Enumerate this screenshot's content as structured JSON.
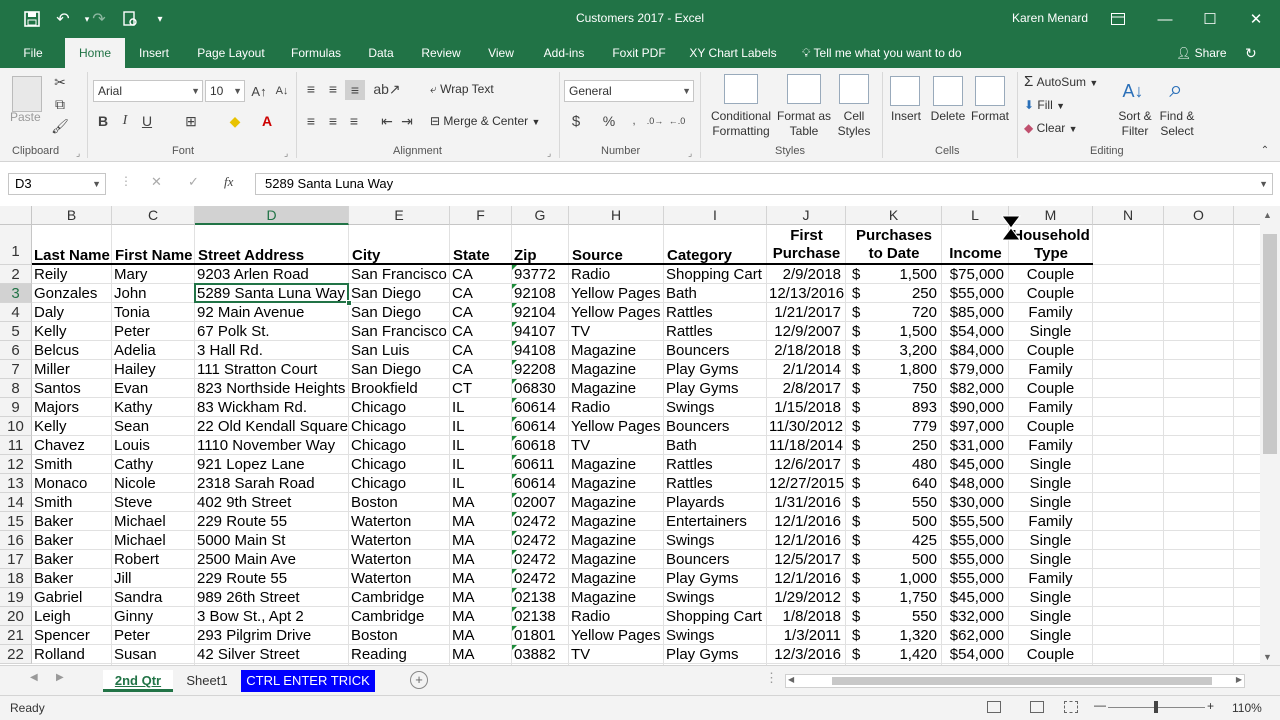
{
  "window": {
    "title": "Customers 2017 - Excel",
    "user": "Karen Menard"
  },
  "ribbon_tabs": [
    "File",
    "Home",
    "Insert",
    "Page Layout",
    "Formulas",
    "Data",
    "Review",
    "View",
    "Add-ins",
    "Foxit PDF",
    "XY Chart Labels"
  ],
  "active_tab": "Home",
  "tell_me": "Tell me what you want to do",
  "share_label": "Share",
  "ribbon": {
    "clipboard": {
      "label": "Clipboard",
      "paste": "Paste"
    },
    "font": {
      "label": "Font",
      "name": "Arial",
      "size": "10",
      "bold": "B",
      "italic": "I",
      "underline": "U"
    },
    "alignment": {
      "label": "Alignment",
      "wrap_text": "Wrap Text",
      "merge_center": "Merge & Center"
    },
    "number": {
      "label": "Number",
      "format": "General",
      "currency": "$",
      "percent": "%"
    },
    "styles": {
      "label": "Styles",
      "cond_fmt_1": "Conditional",
      "cond_fmt_2": "Formatting",
      "fmt_table_1": "Format as",
      "fmt_table_2": "Table",
      "cell_styles_1": "Cell",
      "cell_styles_2": "Styles"
    },
    "cells": {
      "label": "Cells",
      "insert": "Insert",
      "delete": "Delete",
      "format": "Format"
    },
    "editing": {
      "label": "Editing",
      "autosum": "AutoSum",
      "fill": "Fill",
      "clear": "Clear",
      "sort_1": "Sort &",
      "sort_2": "Filter",
      "find_1": "Find &",
      "find_2": "Select"
    }
  },
  "name_box": "D3",
  "formula": "5289 Santa Luna Way",
  "selected_cell": "D3",
  "columns": [
    "B",
    "C",
    "D",
    "E",
    "F",
    "G",
    "H",
    "I",
    "J",
    "K",
    "L",
    "M",
    "N",
    "O"
  ],
  "headers": {
    "B": "Last Name",
    "C": "First Name",
    "D": "Street Address",
    "E": "City",
    "F": "State",
    "G": "Zip",
    "H": "Source",
    "I": "Category",
    "J1": "First",
    "J2": "Purchase",
    "K1": "Purchases",
    "K2": "to Date",
    "L": "Income",
    "M1": "Household",
    "M2": "Type"
  },
  "rows": [
    {
      "n": "2",
      "last": "Reily",
      "first": "Mary",
      "street": "9203 Arlen Road",
      "city": "San Francisco",
      "state": "CA",
      "zip": "93772",
      "source": "Radio",
      "category": "Shopping Cart C",
      "date": "2/9/2018",
      "cur": "$",
      "purchases": "1,500",
      "income": "$75,000",
      "type": "Couple"
    },
    {
      "n": "3",
      "last": "Gonzales",
      "first": "John",
      "street": "5289 Santa Luna Way",
      "city": "San Diego",
      "state": "CA",
      "zip": "92108",
      "source": "Yellow Pages",
      "category": "Bath",
      "date": "12/13/2016",
      "cur": "$",
      "purchases": "250",
      "income": "$55,000",
      "type": "Couple"
    },
    {
      "n": "4",
      "last": "Daly",
      "first": "Tonia",
      "street": "92 Main Avenue",
      "city": "San Diego",
      "state": "CA",
      "zip": "92104",
      "source": "Yellow Pages",
      "category": "Rattles",
      "date": "1/21/2017",
      "cur": "$",
      "purchases": "720",
      "income": "$85,000",
      "type": "Family"
    },
    {
      "n": "5",
      "last": "Kelly",
      "first": "Peter",
      "street": "67 Polk St.",
      "city": "San Francisco",
      "state": "CA",
      "zip": "94107",
      "source": "TV",
      "category": "Rattles",
      "date": "12/9/2007",
      "cur": "$",
      "purchases": "1,500",
      "income": "$54,000",
      "type": "Single"
    },
    {
      "n": "6",
      "last": "Belcus",
      "first": "Adelia",
      "street": "3 Hall Rd.",
      "city": "San Luis",
      "state": "CA",
      "zip": "94108",
      "source": "Magazine",
      "category": "Bouncers",
      "date": "2/18/2018",
      "cur": "$",
      "purchases": "3,200",
      "income": "$84,000",
      "type": "Couple"
    },
    {
      "n": "7",
      "last": "Miller",
      "first": "Hailey",
      "street": "111 Stratton Court",
      "city": "San Diego",
      "state": "CA",
      "zip": "92208",
      "source": "Magazine",
      "category": "Play Gyms",
      "date": "2/1/2014",
      "cur": "$",
      "purchases": "1,800",
      "income": "$79,000",
      "type": "Family"
    },
    {
      "n": "8",
      "last": "Santos",
      "first": "Evan",
      "street": "823 Northside Heights",
      "city": "Brookfield",
      "state": "CT",
      "zip": "06830",
      "source": "Magazine",
      "category": "Play Gyms",
      "date": "2/8/2017",
      "cur": "$",
      "purchases": "750",
      "income": "$82,000",
      "type": "Couple"
    },
    {
      "n": "9",
      "last": "Majors",
      "first": "Kathy",
      "street": "83 Wickham Rd.",
      "city": "Chicago",
      "state": "IL",
      "zip": "60614",
      "source": "Radio",
      "category": "Swings",
      "date": "1/15/2018",
      "cur": "$",
      "purchases": "893",
      "income": "$90,000",
      "type": "Family"
    },
    {
      "n": "10",
      "last": "Kelly",
      "first": "Sean",
      "street": "22 Old Kendall Square",
      "city": "Chicago",
      "state": "IL",
      "zip": "60614",
      "source": "Yellow Pages",
      "category": "Bouncers",
      "date": "11/30/2012",
      "cur": "$",
      "purchases": "779",
      "income": "$97,000",
      "type": "Couple"
    },
    {
      "n": "11",
      "last": "Chavez",
      "first": "Louis",
      "street": "1110 November Way",
      "city": "Chicago",
      "state": "IL",
      "zip": "60618",
      "source": "TV",
      "category": "Bath",
      "date": "11/18/2014",
      "cur": "$",
      "purchases": "250",
      "income": "$31,000",
      "type": "Family"
    },
    {
      "n": "12",
      "last": "Smith",
      "first": "Cathy",
      "street": "921 Lopez Lane",
      "city": "Chicago",
      "state": "IL",
      "zip": "60611",
      "source": "Magazine",
      "category": "Rattles",
      "date": "12/6/2017",
      "cur": "$",
      "purchases": "480",
      "income": "$45,000",
      "type": "Single"
    },
    {
      "n": "13",
      "last": "Monaco",
      "first": "Nicole",
      "street": "2318 Sarah Road",
      "city": "Chicago",
      "state": "IL",
      "zip": "60614",
      "source": "Magazine",
      "category": "Rattles",
      "date": "12/27/2015",
      "cur": "$",
      "purchases": "640",
      "income": "$48,000",
      "type": "Single"
    },
    {
      "n": "14",
      "last": "Smith",
      "first": "Steve",
      "street": "402 9th Street",
      "city": "Boston",
      "state": "MA",
      "zip": "02007",
      "source": "Magazine",
      "category": "Playards",
      "date": "1/31/2016",
      "cur": "$",
      "purchases": "550",
      "income": "$30,000",
      "type": "Single"
    },
    {
      "n": "15",
      "last": "Baker",
      "first": "Michael",
      "street": "229 Route 55",
      "city": "Waterton",
      "state": "MA",
      "zip": "02472",
      "source": "Magazine",
      "category": "Entertainers",
      "date": "12/1/2016",
      "cur": "$",
      "purchases": "500",
      "income": "$55,500",
      "type": "Family"
    },
    {
      "n": "16",
      "last": "Baker",
      "first": "Michael",
      "street": "5000 Main St",
      "city": "Waterton",
      "state": "MA",
      "zip": "02472",
      "source": "Magazine",
      "category": "Swings",
      "date": "12/1/2016",
      "cur": "$",
      "purchases": "425",
      "income": "$55,000",
      "type": "Single"
    },
    {
      "n": "17",
      "last": "Baker",
      "first": "Robert",
      "street": "2500 Main Ave",
      "city": "Waterton",
      "state": "MA",
      "zip": "02472",
      "source": "Magazine",
      "category": "Bouncers",
      "date": "12/5/2017",
      "cur": "$",
      "purchases": "500",
      "income": "$55,000",
      "type": "Single"
    },
    {
      "n": "18",
      "last": "Baker",
      "first": "Jill",
      "street": "229 Route 55",
      "city": "Waterton",
      "state": "MA",
      "zip": "02472",
      "source": "Magazine",
      "category": "Play Gyms",
      "date": "12/1/2016",
      "cur": "$",
      "purchases": "1,000",
      "income": "$55,000",
      "type": "Family"
    },
    {
      "n": "19",
      "last": "Gabriel",
      "first": "Sandra",
      "street": "989 26th Street",
      "city": "Cambridge",
      "state": "MA",
      "zip": "02138",
      "source": "Magazine",
      "category": "Swings",
      "date": "1/29/2012",
      "cur": "$",
      "purchases": "1,750",
      "income": "$45,000",
      "type": "Single"
    },
    {
      "n": "20",
      "last": "Leigh",
      "first": "Ginny",
      "street": "3 Bow St., Apt 2",
      "city": "Cambridge",
      "state": "MA",
      "zip": "02138",
      "source": "Radio",
      "category": "Shopping Cart C",
      "date": "1/8/2018",
      "cur": "$",
      "purchases": "550",
      "income": "$32,000",
      "type": "Single"
    },
    {
      "n": "21",
      "last": "Spencer",
      "first": "Peter",
      "street": "293 Pilgrim Drive",
      "city": "Boston",
      "state": "MA",
      "zip": "01801",
      "source": "Yellow Pages",
      "category": "Swings",
      "date": "1/3/2011",
      "cur": "$",
      "purchases": "1,320",
      "income": "$62,000",
      "type": "Single"
    },
    {
      "n": "22",
      "last": "Rolland",
      "first": "Susan",
      "street": "42 Silver Street",
      "city": "Reading",
      "state": "MA",
      "zip": "03882",
      "source": "TV",
      "category": "Play Gyms",
      "date": "12/3/2016",
      "cur": "$",
      "purchases": "1,420",
      "income": "$54,000",
      "type": "Couple"
    }
  ],
  "sheet_tabs": [
    {
      "label": "2nd Qtr",
      "active": true
    },
    {
      "label": "Sheet1",
      "active": false
    },
    {
      "label": "CTRL ENTER TRICK",
      "active": false,
      "color": "#0000ff"
    }
  ],
  "status": {
    "ready": "Ready",
    "zoom": "110%"
  }
}
